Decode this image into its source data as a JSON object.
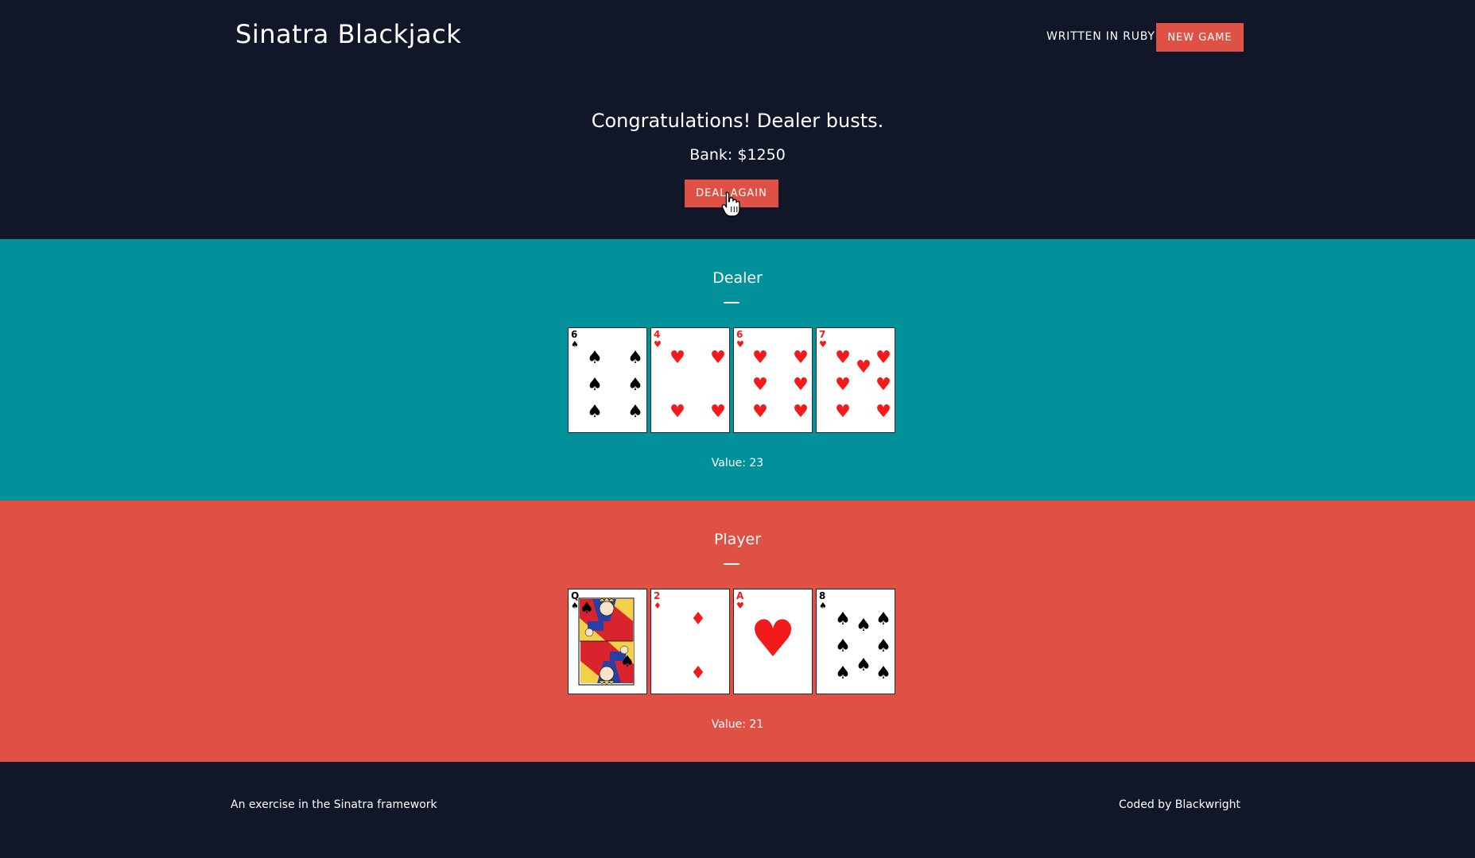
{
  "header": {
    "brand": "Sinatra Blackjack",
    "nav_written": "WRITTEN IN RUBY",
    "new_game": "NEW GAME"
  },
  "status": {
    "message": "Congratulations! Dealer busts.",
    "bank": "Bank: $1250",
    "deal_again": "DEAL AGAIN"
  },
  "dealer": {
    "title": "Dealer",
    "value": "Value: 23",
    "cards": [
      {
        "rank": "6",
        "suit": "spades"
      },
      {
        "rank": "4",
        "suit": "hearts"
      },
      {
        "rank": "6",
        "suit": "hearts"
      },
      {
        "rank": "7",
        "suit": "hearts"
      }
    ]
  },
  "player": {
    "title": "Player",
    "value": "Value: 21",
    "cards": [
      {
        "rank": "Q",
        "suit": "spades"
      },
      {
        "rank": "2",
        "suit": "diamonds"
      },
      {
        "rank": "A",
        "suit": "hearts"
      },
      {
        "rank": "8",
        "suit": "spades"
      }
    ]
  },
  "footer": {
    "left": "An exercise in the Sinatra framework",
    "right": "Coded by Blackwright"
  },
  "colors": {
    "navy": "#111629",
    "teal": "#00919a",
    "red": "#e05145",
    "card_red": "#f21a1a"
  },
  "icons": {
    "cursor": "hand-pointer-icon",
    "spade": "spade-icon",
    "heart": "heart-icon",
    "diamond": "diamond-icon"
  }
}
